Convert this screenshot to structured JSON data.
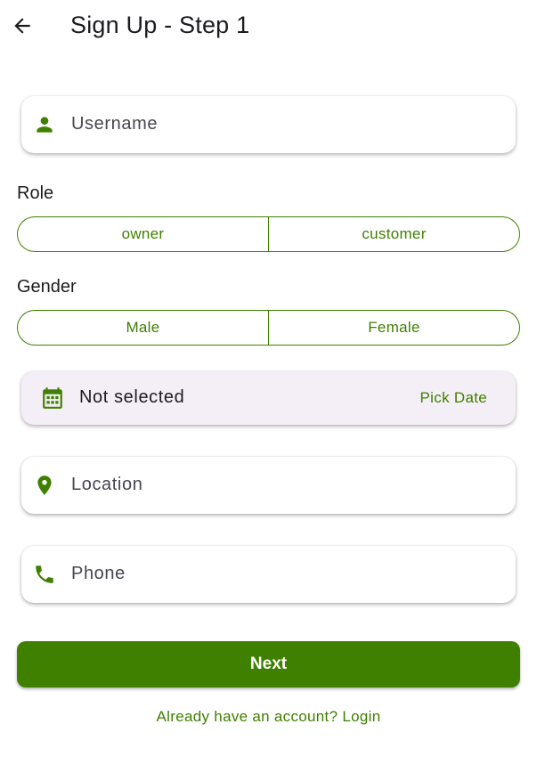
{
  "appbar": {
    "back_icon": "arrow-back-icon",
    "title": "Sign Up - Step 1"
  },
  "username": {
    "icon": "person-icon",
    "placeholder": "Username"
  },
  "role": {
    "label": "Role",
    "options": [
      "owner",
      "customer"
    ]
  },
  "gender": {
    "label": "Gender",
    "options": [
      "Male",
      "Female"
    ]
  },
  "birthdate": {
    "icon": "calendar-icon",
    "value": "Not selected",
    "pick_label": "Pick Date"
  },
  "location": {
    "icon": "location-pin-icon",
    "placeholder": "Location"
  },
  "phone": {
    "icon": "phone-icon",
    "placeholder": "Phone"
  },
  "next_label": "Next",
  "login_link": "Already have an account? Login",
  "colors": {
    "accent": "#3f8000",
    "text": "#1c1b1f",
    "placeholder": "#49454f",
    "date_card_bg": "#f4eff6"
  }
}
